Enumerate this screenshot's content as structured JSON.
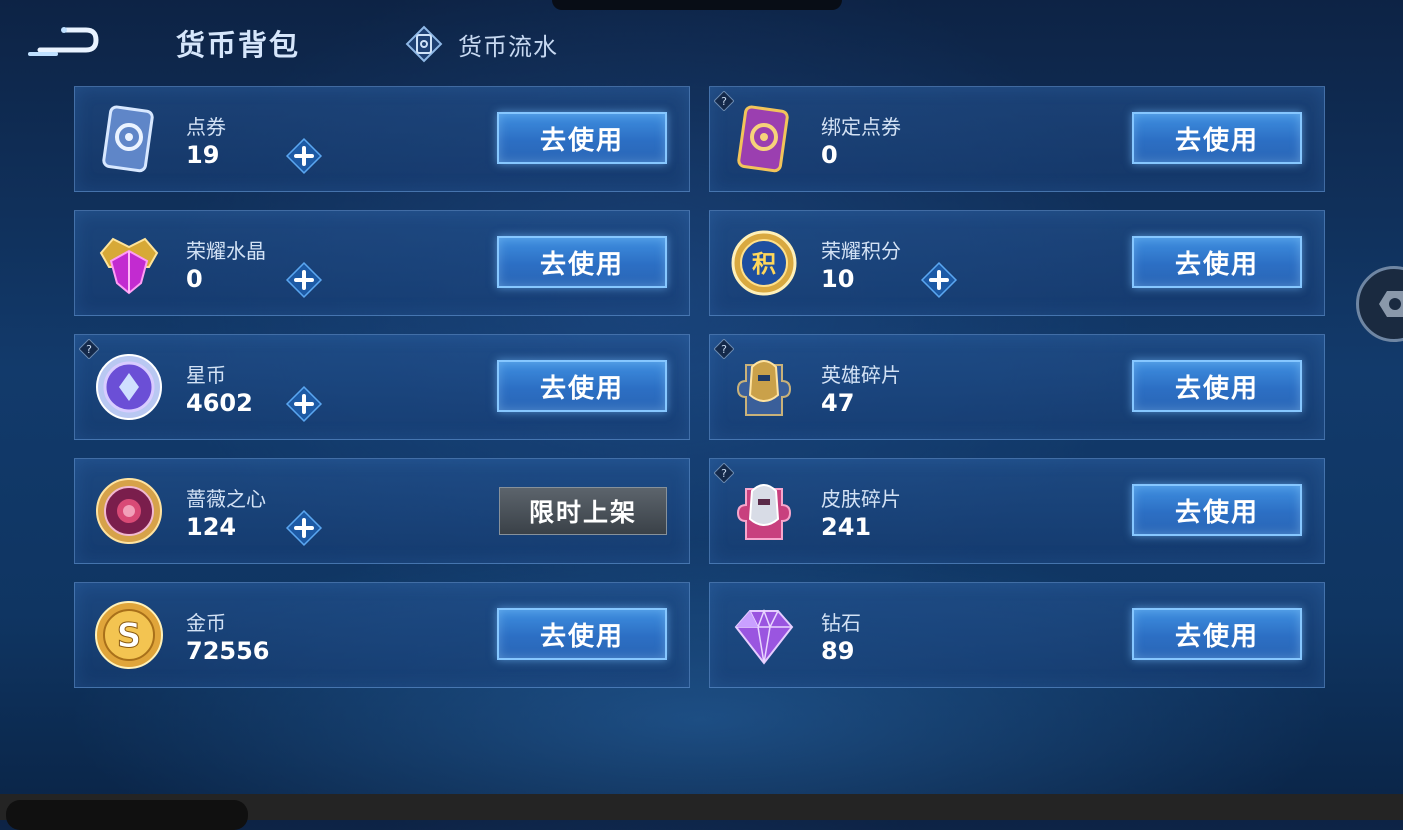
{
  "header": {
    "title": "货币背包",
    "flow_tab_label": "货币流水"
  },
  "currencies": [
    {
      "name": "点券",
      "amount": "19",
      "icon": "coupon-card-icon",
      "has_plus": true,
      "has_help": false,
      "action": "去使用"
    },
    {
      "name": "绑定点券",
      "amount": "0",
      "icon": "bound-coupon-card-icon",
      "has_plus": false,
      "has_help": true,
      "action": "去使用"
    },
    {
      "name": "荣耀水晶",
      "amount": "0",
      "icon": "glory-crystal-icon",
      "has_plus": true,
      "has_help": false,
      "action": "去使用"
    },
    {
      "name": "荣耀积分",
      "amount": "10",
      "icon": "glory-points-icon",
      "has_plus": true,
      "has_help": false,
      "action": "去使用"
    },
    {
      "name": "星币",
      "amount": "4602",
      "icon": "star-coin-icon",
      "has_plus": true,
      "has_help": true,
      "action": "去使用"
    },
    {
      "name": "英雄碎片",
      "amount": "47",
      "icon": "hero-fragment-icon",
      "has_plus": false,
      "has_help": true,
      "action": "去使用"
    },
    {
      "name": "蔷薇之心",
      "amount": "124",
      "icon": "rose-heart-icon",
      "has_plus": true,
      "has_help": false,
      "action": "限时上架"
    },
    {
      "name": "皮肤碎片",
      "amount": "241",
      "icon": "skin-fragment-icon",
      "has_plus": false,
      "has_help": true,
      "action": "去使用"
    },
    {
      "name": "金币",
      "amount": "72556",
      "icon": "gold-coin-icon",
      "has_plus": false,
      "has_help": false,
      "action": "去使用"
    },
    {
      "name": "钻石",
      "amount": "89",
      "icon": "diamond-icon",
      "has_plus": false,
      "has_help": false,
      "action": "去使用"
    }
  ],
  "colors": {
    "accent": "#2c6fc4",
    "background": "#123a6b",
    "limited_button": "#4a5158"
  }
}
